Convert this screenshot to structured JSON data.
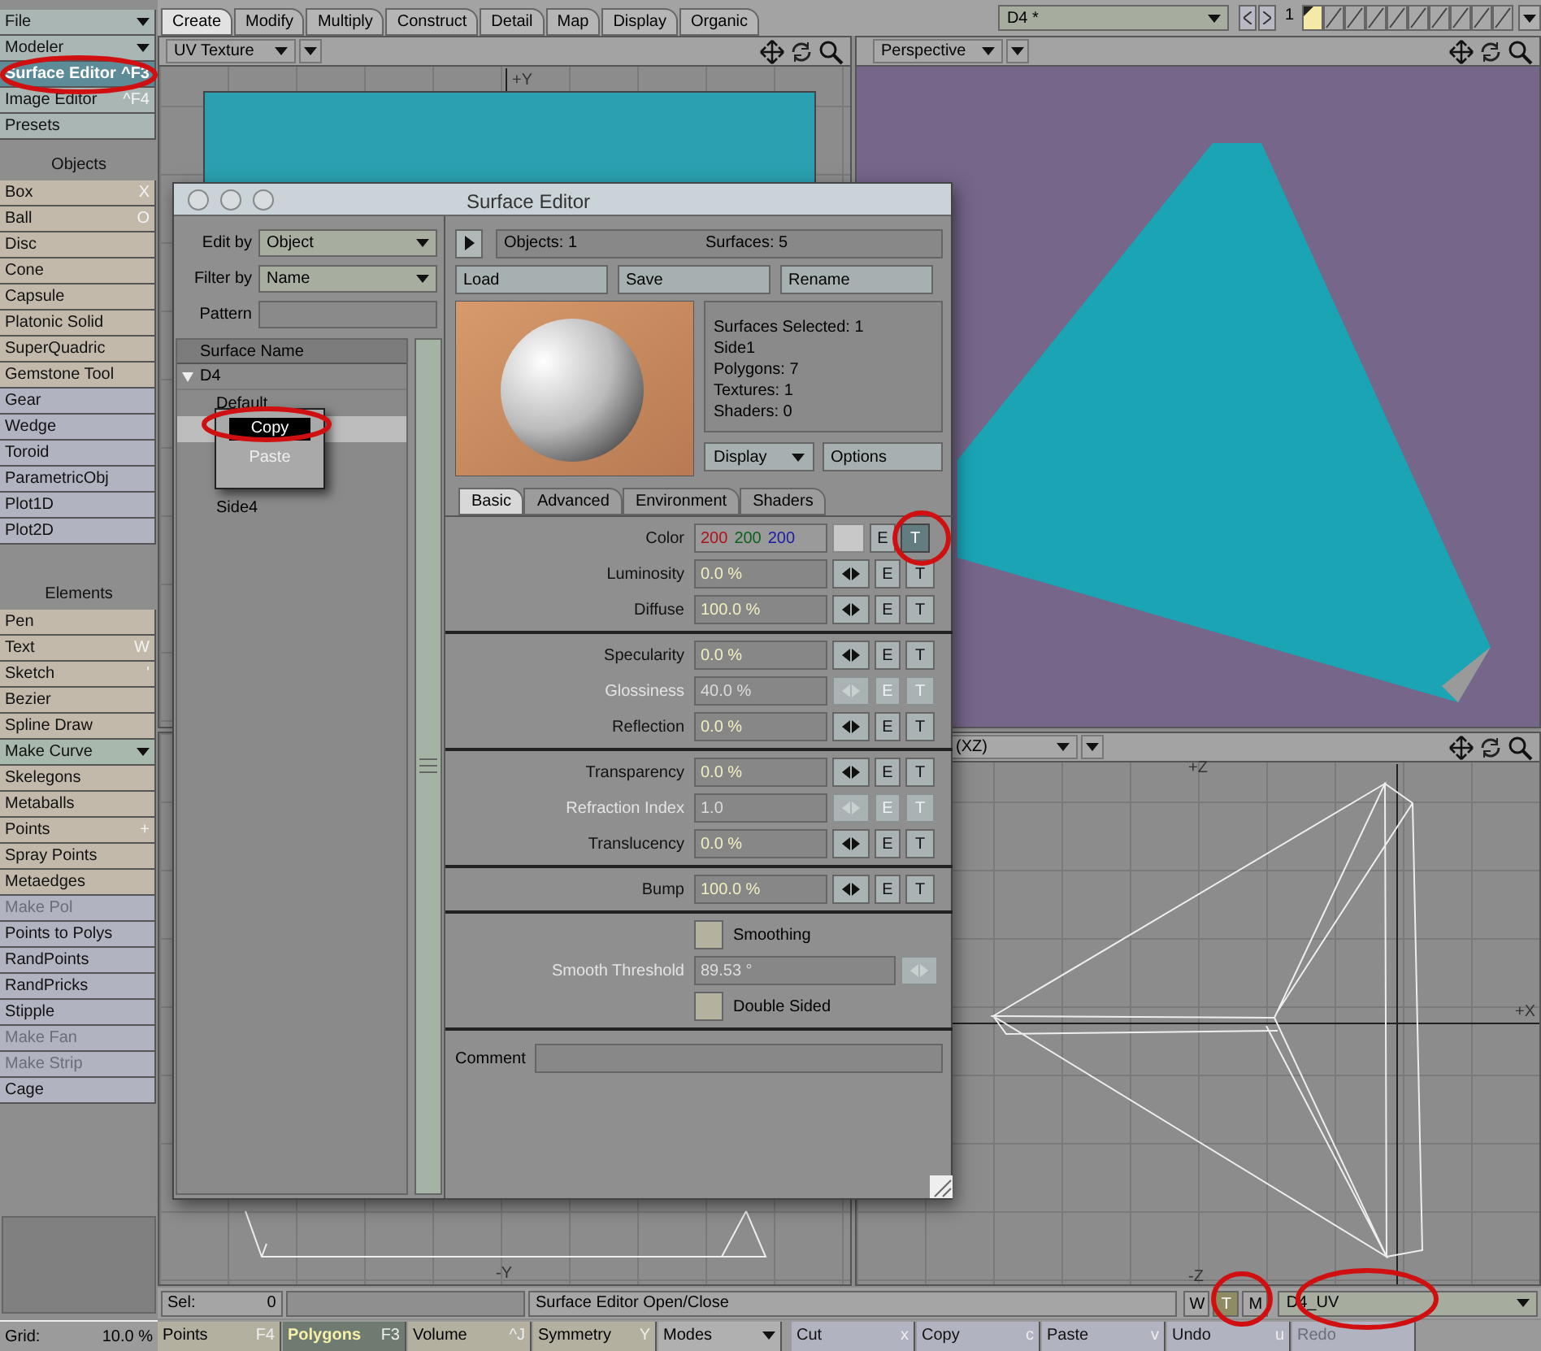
{
  "sidebar": {
    "sections": [
      {
        "items": [
          {
            "kind": "menu",
            "label": "File",
            "color": "#a9b6b4"
          },
          {
            "kind": "menu",
            "label": "Modeler",
            "color": "#a9b6b4"
          },
          {
            "kind": "button",
            "label": "Surface Editor",
            "shortcut": "^F3",
            "selected": true
          },
          {
            "kind": "button",
            "label": "Image Editor",
            "shortcut": "^F4",
            "selected": false,
            "color": "#a9b6b4"
          },
          {
            "kind": "button",
            "label": "Presets",
            "selected": false,
            "color": "#a9b6b4"
          }
        ]
      },
      {
        "title": "Objects",
        "items": [
          {
            "kind": "button",
            "label": "Box",
            "shortcut": "X",
            "color": "#c2b9ab"
          },
          {
            "kind": "button",
            "label": "Ball",
            "shortcut": "O",
            "color": "#c2b9ab"
          },
          {
            "kind": "button",
            "label": "Disc",
            "color": "#c2b9ab"
          },
          {
            "kind": "button",
            "label": "Cone",
            "color": "#c2b9ab"
          },
          {
            "kind": "button",
            "label": "Capsule",
            "color": "#c2b9ab"
          },
          {
            "kind": "button",
            "label": "Platonic Solid",
            "color": "#c2b9ab"
          },
          {
            "kind": "button",
            "label": "SuperQuadric",
            "color": "#c2b9ab"
          },
          {
            "kind": "button",
            "label": "Gemstone Tool",
            "color": "#c2b9ab"
          },
          {
            "kind": "button",
            "label": "Gear",
            "color": "#b1b3c0"
          },
          {
            "kind": "button",
            "label": "Wedge",
            "color": "#b1b3c0"
          },
          {
            "kind": "button",
            "label": "Toroid",
            "color": "#b1b3c0"
          },
          {
            "kind": "button",
            "label": "ParametricObj",
            "color": "#b1b3c0"
          },
          {
            "kind": "button",
            "label": "Plot1D",
            "color": "#b1b3c0"
          },
          {
            "kind": "button",
            "label": "Plot2D",
            "color": "#b1b3c0"
          }
        ]
      },
      {
        "title": "Elements",
        "items": [
          {
            "kind": "button",
            "label": "Pen",
            "color": "#c2b9ab"
          },
          {
            "kind": "button",
            "label": "Text",
            "shortcut": "W",
            "color": "#c2b9ab"
          },
          {
            "kind": "button",
            "label": "Sketch",
            "shortcut": "'",
            "color": "#c2b9ab"
          },
          {
            "kind": "button",
            "label": "Bezier",
            "color": "#c2b9ab"
          },
          {
            "kind": "button",
            "label": "Spline Draw",
            "color": "#c2b9ab"
          },
          {
            "kind": "menu",
            "label": "Make Curve",
            "color": "#a9b8ac"
          },
          {
            "kind": "button",
            "label": "Skelegons",
            "color": "#c2b9ab"
          },
          {
            "kind": "button",
            "label": "Metaballs",
            "color": "#c2b9ab"
          },
          {
            "kind": "button",
            "label": "Points",
            "shortcut": "+",
            "color": "#c2b9ab"
          },
          {
            "kind": "button",
            "label": "Spray Points",
            "color": "#c2b9ab"
          },
          {
            "kind": "button",
            "label": "Metaedges",
            "color": "#c2b9ab"
          },
          {
            "kind": "button",
            "label": "Make Pol",
            "disabled": true,
            "color": "#b1b3c0"
          },
          {
            "kind": "button",
            "label": "Points to Polys",
            "color": "#b1b3c0"
          },
          {
            "kind": "button",
            "label": "RandPoints",
            "color": "#b1b3c0"
          },
          {
            "kind": "button",
            "label": "RandPricks",
            "color": "#b1b3c0"
          },
          {
            "kind": "button",
            "label": "Stipple",
            "color": "#b1b3c0"
          },
          {
            "kind": "button",
            "label": "Make Fan",
            "disabled": true,
            "color": "#b1b3c0"
          },
          {
            "kind": "button",
            "label": "Make Strip",
            "disabled": true,
            "color": "#b1b3c0"
          },
          {
            "kind": "button",
            "label": "Cage",
            "color": "#b1b3c0"
          }
        ]
      }
    ],
    "grid": {
      "label": "Grid:",
      "value": "10.0 %"
    }
  },
  "tabs": [
    {
      "label": "Create",
      "selected": true
    },
    {
      "label": "Modify",
      "selected": false
    },
    {
      "label": "Multiply",
      "selected": false
    },
    {
      "label": "Construct",
      "selected": false
    },
    {
      "label": "Detail",
      "selected": false
    },
    {
      "label": "Map",
      "selected": false
    },
    {
      "label": "Display",
      "selected": false
    },
    {
      "label": "Organic",
      "selected": false
    }
  ],
  "object_selector": {
    "value": "D4 *",
    "layer_number": "1"
  },
  "layers": [
    {
      "selected": true
    },
    {
      "selected": false
    },
    {
      "selected": false
    },
    {
      "selected": false
    },
    {
      "selected": false
    },
    {
      "selected": false
    },
    {
      "selected": false
    },
    {
      "selected": false
    },
    {
      "selected": false
    },
    {
      "selected": false
    }
  ],
  "viewports": [
    {
      "title": "UV Texture",
      "axis_labels": [
        "+Y",
        "-Y"
      ]
    },
    {
      "title": "Perspective"
    },
    {
      "title": "(XZ)",
      "axis_labels": [
        "+Z",
        "-Z",
        "+X"
      ]
    }
  ],
  "surface_editor": {
    "title": "Surface Editor",
    "edit_by": {
      "label": "Edit by",
      "value": "Object"
    },
    "filter_by": {
      "label": "Filter by",
      "value": "Name"
    },
    "pattern": {
      "label": "Pattern"
    },
    "list_header": "Surface Name",
    "tree": [
      {
        "label": "D4",
        "expanded": true,
        "children": [
          {
            "label": "Default",
            "selected": false
          },
          {
            "selected": true
          },
          {
            "selected": false
          },
          {
            "selected": false
          },
          {
            "label": "Side4",
            "selected": false
          }
        ]
      }
    ],
    "context_menu": [
      {
        "label": "Copy",
        "selected": true
      },
      {
        "label": "Paste",
        "selected": false
      }
    ],
    "objects": "Objects: 1",
    "surfaces": "Surfaces: 5",
    "buttons": [
      "Load",
      "Save",
      "Rename"
    ],
    "info": [
      "Surfaces Selected: 1",
      "Side1",
      "Polygons: 7",
      "Textures: 1",
      "Shaders: 0"
    ],
    "display": "Display",
    "options": "Options",
    "tabs": [
      {
        "label": "Basic",
        "selected": true
      },
      {
        "label": "Advanced",
        "selected": false
      },
      {
        "label": "Environment",
        "selected": false
      },
      {
        "label": "Shaders",
        "selected": false
      }
    ],
    "groups": [
      [
        {
          "kind": "color",
          "label": "Color",
          "r": "200",
          "g": "200",
          "b": "200",
          "e": "E",
          "t": "T",
          "texture_on": true
        },
        {
          "kind": "value",
          "label": "Luminosity",
          "value": "0.0 %",
          "disabled": false,
          "e": "E",
          "t": "T"
        },
        {
          "kind": "value",
          "label": "Diffuse",
          "value": "100.0 %",
          "disabled": false,
          "e": "E",
          "t": "T"
        }
      ],
      [
        {
          "kind": "value",
          "label": "Specularity",
          "value": "0.0 %",
          "disabled": false,
          "e": "E",
          "t": "T"
        },
        {
          "kind": "value",
          "label": "Glossiness",
          "value": "40.0 %",
          "disabled": true,
          "e": "E",
          "t": "T"
        },
        {
          "kind": "value",
          "label": "Reflection",
          "value": "0.0 %",
          "disabled": false,
          "e": "E",
          "t": "T"
        }
      ],
      [
        {
          "kind": "value",
          "label": "Transparency",
          "value": "0.0 %",
          "disabled": false,
          "e": "E",
          "t": "T"
        },
        {
          "kind": "value",
          "label": "Refraction Index",
          "value": "1.0",
          "disabled": true,
          "e": "E",
          "t": "T"
        },
        {
          "kind": "value",
          "label": "Translucency",
          "value": "0.0 %",
          "disabled": false,
          "e": "E",
          "t": "T"
        }
      ],
      [
        {
          "kind": "value",
          "label": "Bump",
          "value": "100.0 %",
          "disabled": false,
          "e": "E",
          "t": "T"
        }
      ],
      [
        {
          "kind": "checkbox",
          "label": "Smoothing",
          "checked": false
        },
        {
          "kind": "slider",
          "label": "Smooth Threshold",
          "value": "89.53 °",
          "disabled": true
        },
        {
          "kind": "checkbox",
          "label": "Double Sided",
          "checked": false
        }
      ]
    ],
    "comment": {
      "label": "Comment"
    }
  },
  "status_bar": {
    "sel_label": "Sel:",
    "sel_value": "0",
    "message": "Surface Editor Open/Close",
    "toggles": [
      {
        "label": "W",
        "selected": false
      },
      {
        "label": "T",
        "selected": true
      },
      {
        "label": "M",
        "selected": false
      }
    ],
    "map": "D4_UV"
  },
  "bottom_buttons": [
    {
      "kind": "mode",
      "label": "Points",
      "shortcut": "F4",
      "selected": false
    },
    {
      "kind": "mode",
      "label": "Polygons",
      "shortcut": "F3",
      "selected": true
    },
    {
      "kind": "mode",
      "label": "Volume",
      "shortcut": "^J",
      "selected": false
    },
    {
      "kind": "mode",
      "label": "Symmetry",
      "shortcut": "Y",
      "selected": false
    },
    {
      "kind": "menu",
      "label": "Modes"
    },
    {
      "kind": "action",
      "label": "Cut",
      "shortcut": "x",
      "disabled": false
    },
    {
      "kind": "action",
      "label": "Copy",
      "shortcut": "c",
      "disabled": false
    },
    {
      "kind": "action",
      "label": "Paste",
      "shortcut": "v",
      "disabled": false
    },
    {
      "kind": "action",
      "label": "Undo",
      "shortcut": "u",
      "disabled": false
    },
    {
      "kind": "action",
      "label": "Redo",
      "disabled": true
    }
  ]
}
